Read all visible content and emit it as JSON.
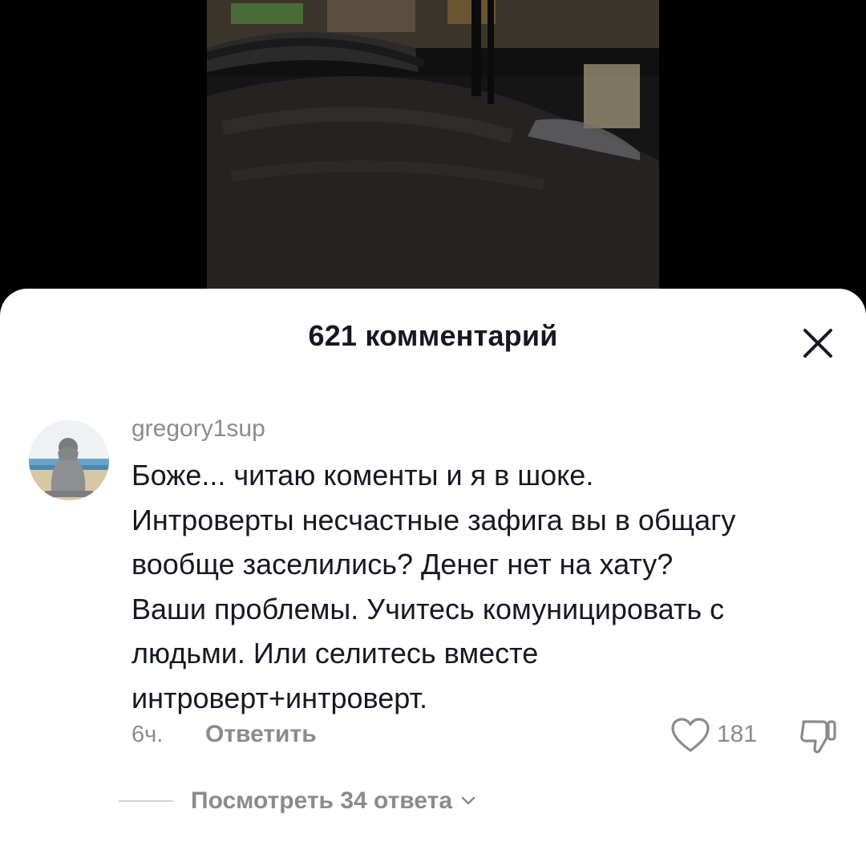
{
  "comments_sheet": {
    "title": "621 комментарий",
    "close_icon": "close-icon"
  },
  "comment": {
    "username": "gregory1sup",
    "text_lines": [
      "Боже... читаю коменты и я в шоке.",
      "Интроверты несчастные зафига вы в общагу",
      "вообще заселились? Денег нет на хату?",
      "Ваши проблемы. Учитесь комуницировать с",
      "людьми. Или селитесь вместе",
      "интроверт+интроверт."
    ],
    "time": "6ч.",
    "reply_label": "Ответить",
    "likes": "181",
    "like_icon": "heart-outline-icon",
    "dislike_icon": "thumbs-down-icon",
    "view_replies_label": "Посмотреть 34 ответа",
    "view_replies_icon": "chevron-down-icon"
  },
  "colors": {
    "text_primary": "#161823",
    "text_secondary": "#8a8b91",
    "sheet_bg": "#ffffff",
    "backdrop": "#000000"
  }
}
